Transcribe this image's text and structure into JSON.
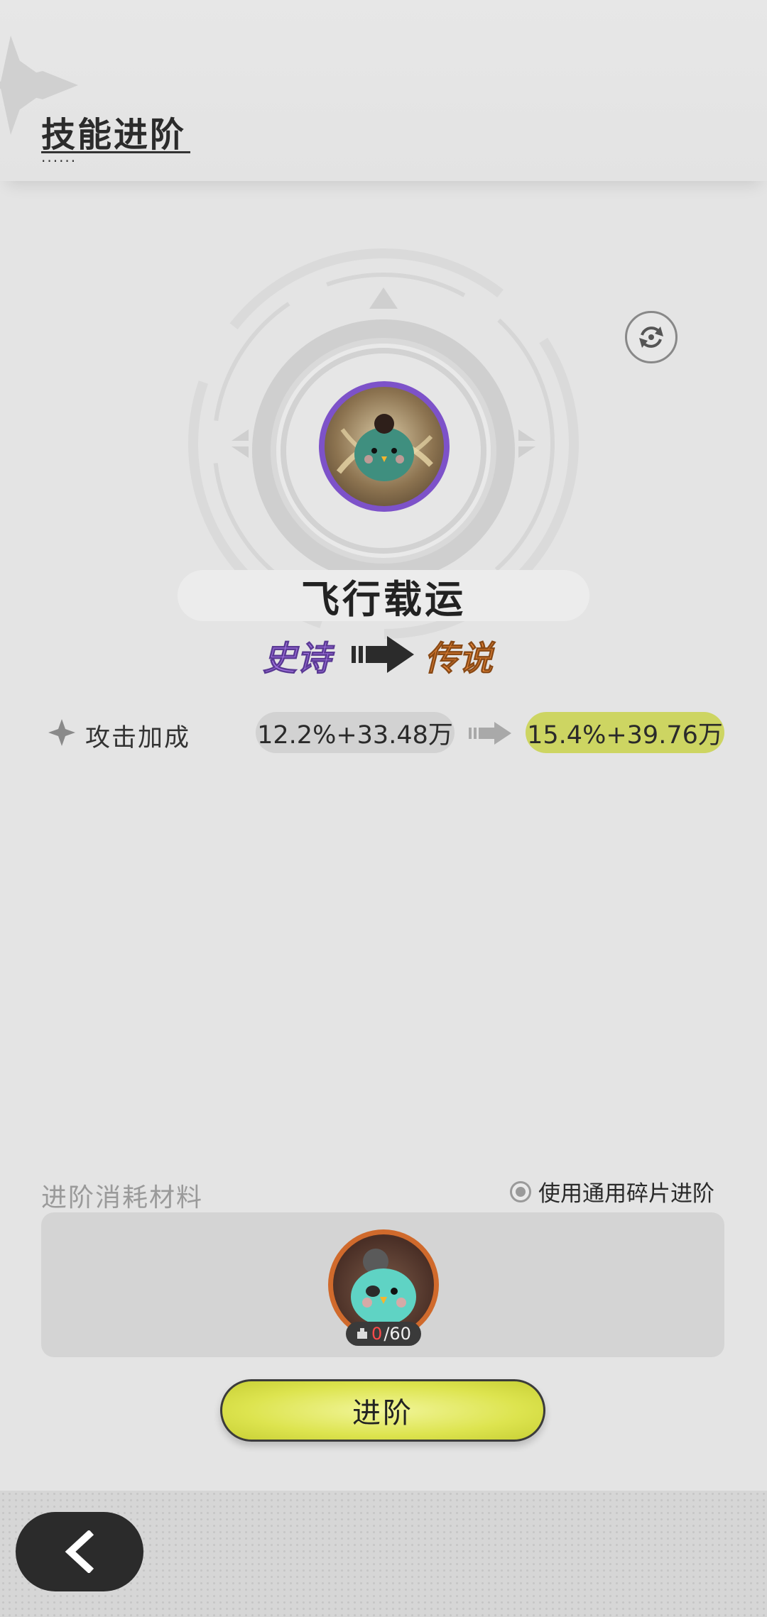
{
  "header": {
    "title": "技能进阶"
  },
  "skill": {
    "name": "飞行载运",
    "rarity_from": "史诗",
    "rarity_to": "传说",
    "rarity_from_color": "#a777e6",
    "rarity_to_color": "#f08b3a",
    "icon": "flying-bird-icon"
  },
  "stats": [
    {
      "label": "攻击加成",
      "from": "12.2%+33.48万",
      "to": "15.4%+39.76万"
    }
  ],
  "materials": {
    "title": "进阶消耗材料",
    "use_common_label": "使用通用碎片进阶",
    "item_icon": "bird-shard-icon",
    "have": "0",
    "need": "/60"
  },
  "actions": {
    "advance_label": "进阶",
    "back_icon": "chevron-left-icon",
    "refresh_icon": "refresh-icon"
  },
  "colors": {
    "accent_yellow": "#dde44f",
    "panel": "#d4d4d4",
    "dark": "#2b2b2b"
  }
}
